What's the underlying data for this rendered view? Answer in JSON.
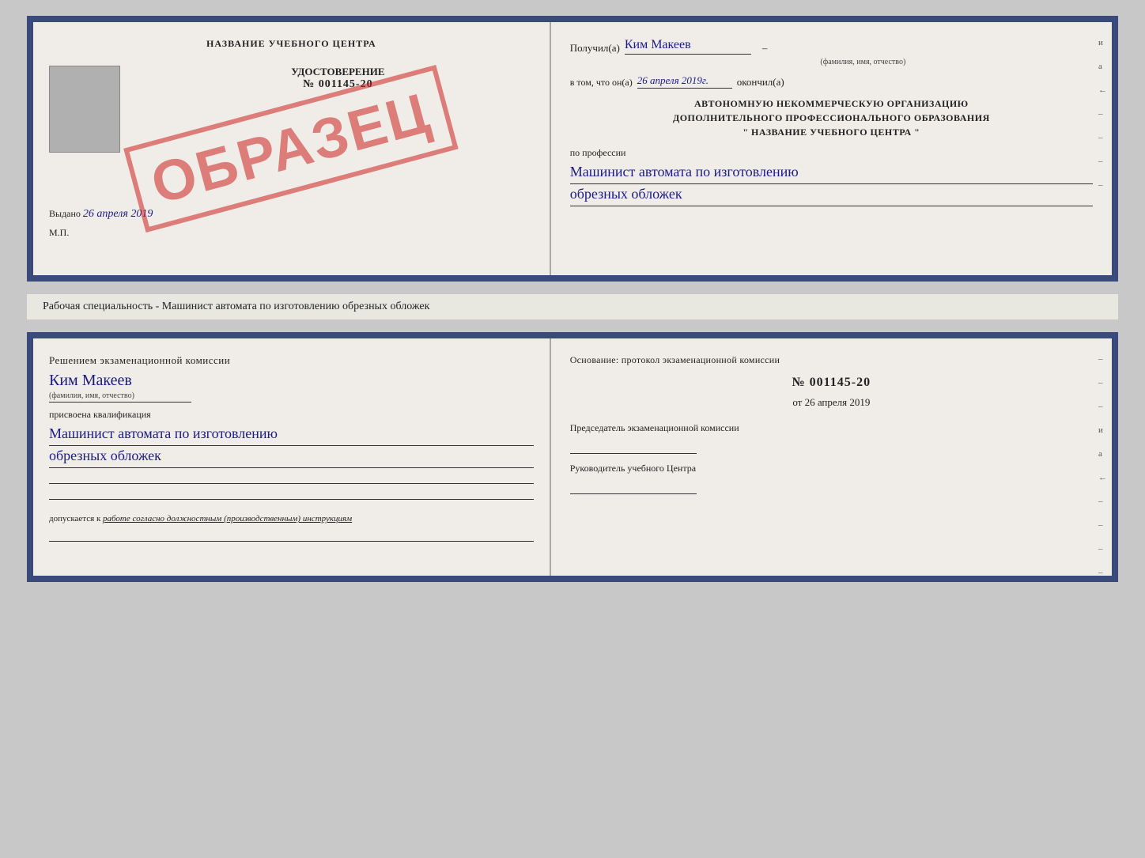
{
  "topDoc": {
    "left": {
      "centerTitle": "НАЗВАНИЕ УЧЕБНОГО ЦЕНТРА",
      "stamp": "ОБРАЗЕЦ",
      "udostTitle": "УДОСТОВЕРЕНИЕ",
      "udostNumber": "№ 001145-20",
      "vydanoLabel": "Выдано",
      "vydanoDate": "26 апреля 2019",
      "mpLabel": "М.П."
    },
    "right": {
      "poluchilLabel": "Получил(а)",
      "recipientName": "Ким Макеев",
      "fioLabel": "(фамилия, имя, отчество)",
      "vtomLabel": "в том, что он(а)",
      "completionDate": "26 апреля 2019г.",
      "okonchilLabel": "окончил(а)",
      "orgLine1": "АВТОНОМНУЮ НЕКОММЕРЧЕСКУЮ ОРГАНИЗАЦИЮ",
      "orgLine2": "ДОПОЛНИТЕЛЬНОГО ПРОФЕССИОНАЛЬНОГО ОБРАЗОВАНИЯ",
      "orgLine3": "\"  НАЗВАНИЕ УЧЕБНОГО ЦЕНТРА  \"",
      "poProfessiiLabel": "по профессии",
      "profession1": "Машинист автомата по изготовлению",
      "profession2": "обрезных обложек",
      "sideMarks": [
        "и",
        "а",
        "←",
        "–",
        "–",
        "–",
        "–"
      ]
    }
  },
  "descriptionLine": "Рабочая специальность - Машинист автомата по изготовлению обрезных обложек",
  "bottomDoc": {
    "left": {
      "resheniyemText": "Решением экзаменационной комиссии",
      "nameHandwritten": "Ким Макеев",
      "fioLabel": "(фамилия, имя, отчество)",
      "prisvoenaLabel": "присвоена квалификация",
      "qualification1": "Машинист автомата по изготовлению",
      "qualification2": "обрезных обложек",
      "dopuskaetsyaText": "допускается к",
      "dopuskaetsyaItalic": "работе согласно должностным (производственным) инструкциям"
    },
    "right": {
      "osnovaniyeText": "Основание: протокол экзаменационной комиссии",
      "protocolNumber": "№ 001145-20",
      "otDate": "от 26 апреля 2019",
      "predsedatelText": "Председатель экзаменационной комиссии",
      "rukovoditelText": "Руководитель учебного Центра",
      "sideMarks": [
        "–",
        "–",
        "–",
        "и",
        "а",
        "←",
        "–",
        "–",
        "–",
        "–"
      ]
    }
  }
}
